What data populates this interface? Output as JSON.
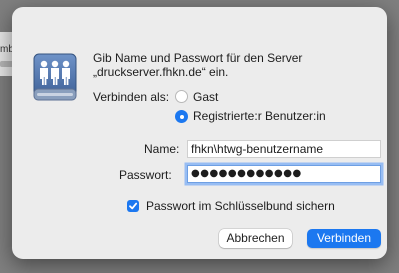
{
  "background_window": {
    "partial_text": "mb"
  },
  "dialog": {
    "prompt_line1": "Gib Name und Passwort für den Server",
    "prompt_line2": "„druckserver.fhkn.de“ ein.",
    "connect_as_label": "Verbinden als:",
    "options": [
      {
        "label": "Gast",
        "selected": false
      },
      {
        "label": "Registrierte:r Benutzer:in",
        "selected": true
      }
    ],
    "name_label": "Name:",
    "name_value": "fhkn\\htwg-benutzername",
    "password_label": "Passwort:",
    "password_mask": "●●●●●●●●●●●●",
    "keychain_checkbox": {
      "label": "Passwort im Schlüsselbund sichern",
      "checked": true
    },
    "cancel_label": "Abbrechen",
    "connect_label": "Verbinden"
  },
  "colors": {
    "accent": "#1c78f0",
    "sheet": "#ececec",
    "backdrop": "#7f7f7f"
  },
  "icons": {
    "server": "shared-server-people-icon",
    "check": "checkmark-icon"
  }
}
